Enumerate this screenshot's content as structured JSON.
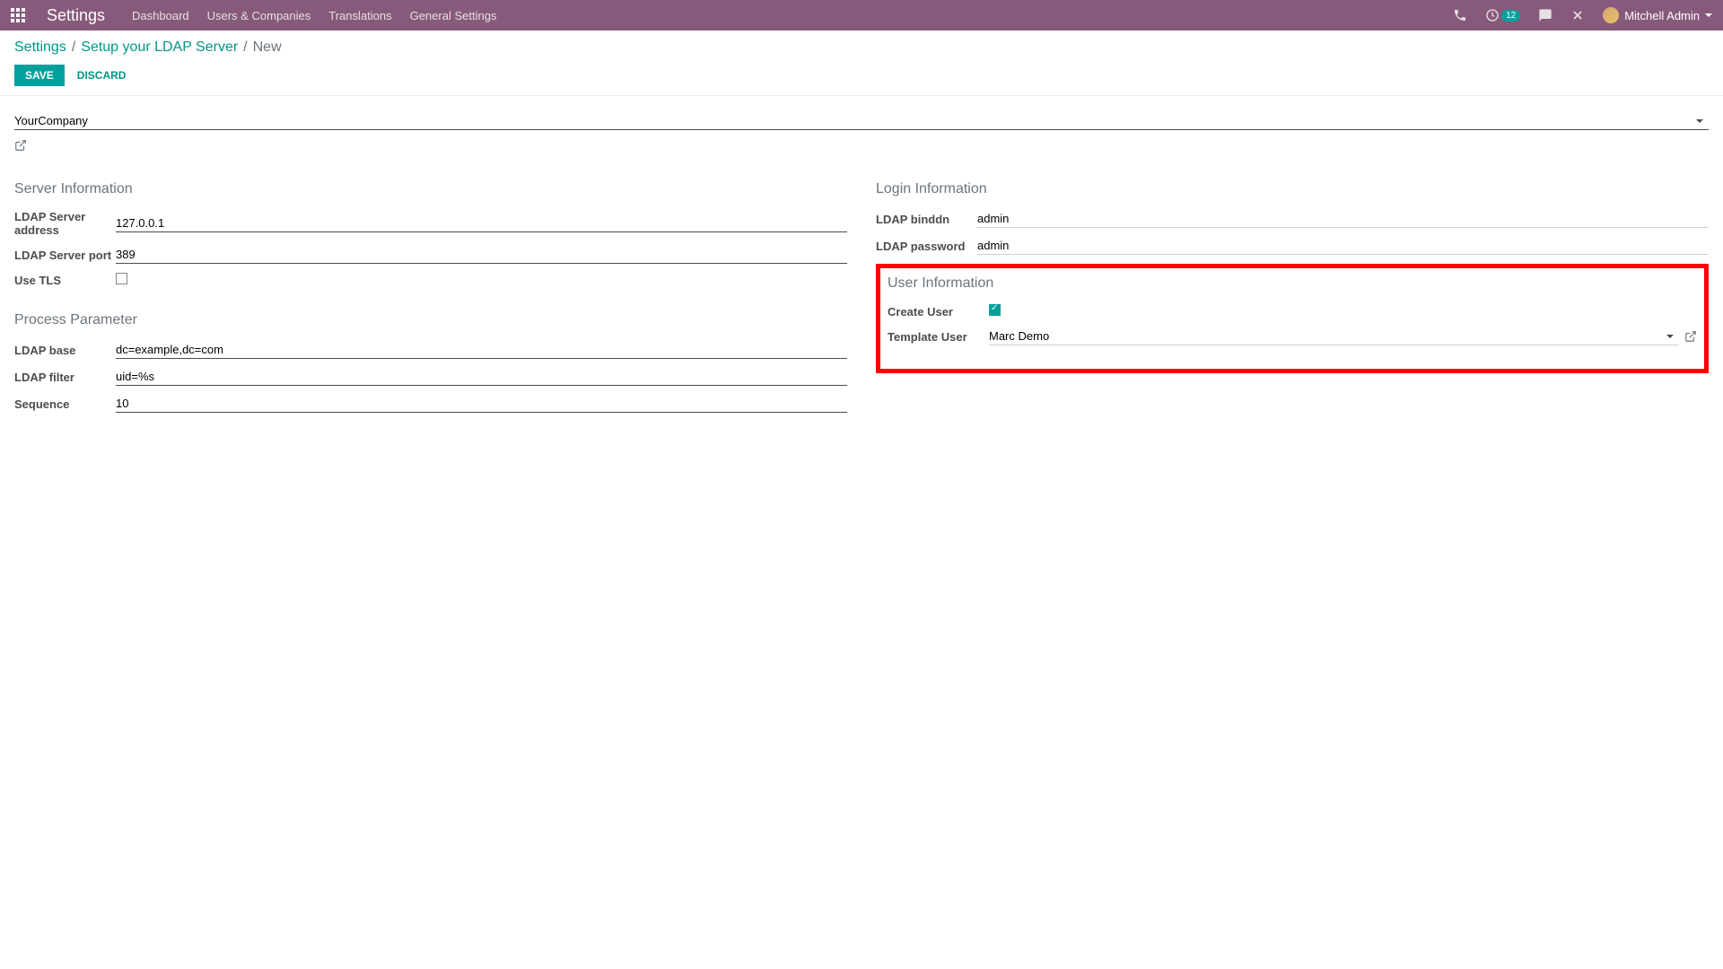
{
  "topbar": {
    "brand": "Settings",
    "nav": [
      "Dashboard",
      "Users & Companies",
      "Translations",
      "General Settings"
    ],
    "notification_count": "12",
    "user_name": "Mitchell Admin"
  },
  "breadcrumbs": {
    "parts": [
      "Settings",
      "Setup your LDAP Server"
    ],
    "current": "New"
  },
  "actions": {
    "save": "Save",
    "discard": "Discard"
  },
  "company": {
    "value": "YourCompany"
  },
  "sections": {
    "server_info": {
      "title": "Server Information",
      "fields": {
        "address": {
          "label": "LDAP Server address",
          "value": "127.0.0.1"
        },
        "port": {
          "label": "LDAP Server port",
          "value": "389"
        },
        "tls": {
          "label": "Use TLS",
          "checked": false
        }
      }
    },
    "process_param": {
      "title": "Process Parameter",
      "fields": {
        "base": {
          "label": "LDAP base",
          "value": "dc=example,dc=com"
        },
        "filter": {
          "label": "LDAP filter",
          "value": "uid=%s"
        },
        "sequence": {
          "label": "Sequence",
          "value": "10"
        }
      }
    },
    "login_info": {
      "title": "Login Information",
      "fields": {
        "binddn": {
          "label": "LDAP binddn",
          "value": "admin"
        },
        "password": {
          "label": "LDAP password",
          "value": "admin"
        }
      }
    },
    "user_info": {
      "title": "User Information",
      "fields": {
        "create_user": {
          "label": "Create User",
          "checked": true
        },
        "template_user": {
          "label": "Template User",
          "value": "Marc Demo"
        }
      }
    }
  }
}
